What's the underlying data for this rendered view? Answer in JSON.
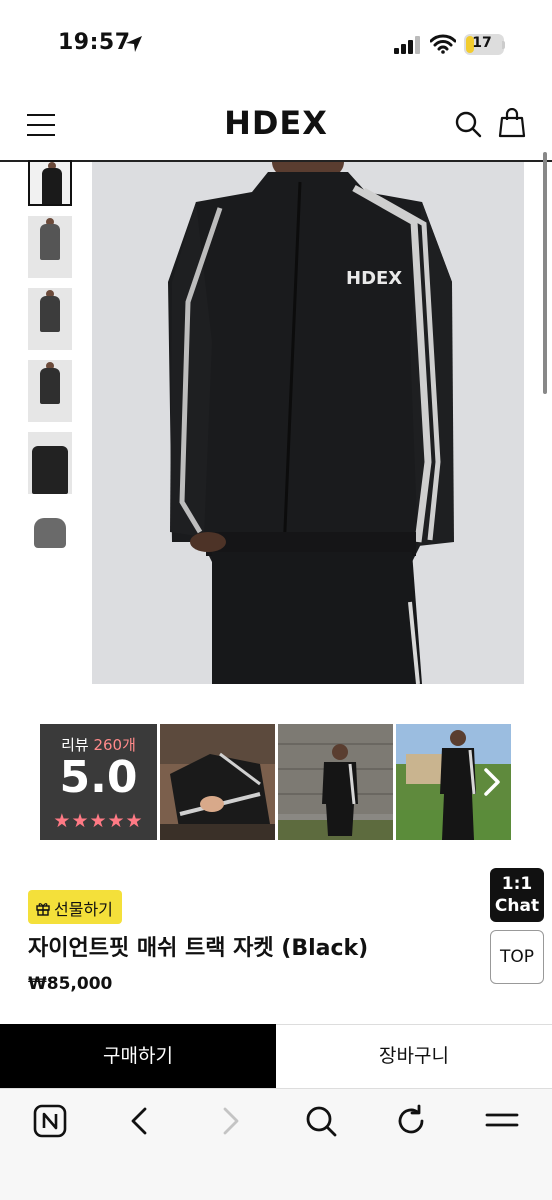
{
  "status_bar": {
    "time": "19:57",
    "battery_level": "17"
  },
  "header": {
    "brand": "HDEX"
  },
  "reviews": {
    "label": "리뷰",
    "count": "260개",
    "score": "5.0",
    "stars": "★★★★★"
  },
  "product": {
    "gift_label": "선물하기",
    "name": "자이언트핏 매쉬 트랙 자켓 (Black)",
    "price": "₩85,000"
  },
  "floating": {
    "chat_line1": "1:1",
    "chat_line2": "Chat",
    "top": "TOP"
  },
  "actions": {
    "buy": "구매하기",
    "cart": "장바구니"
  },
  "colors": {
    "gift_bg": "#f4e03a",
    "stars": "#ff7a85",
    "review_count": "#ff8a8a"
  }
}
